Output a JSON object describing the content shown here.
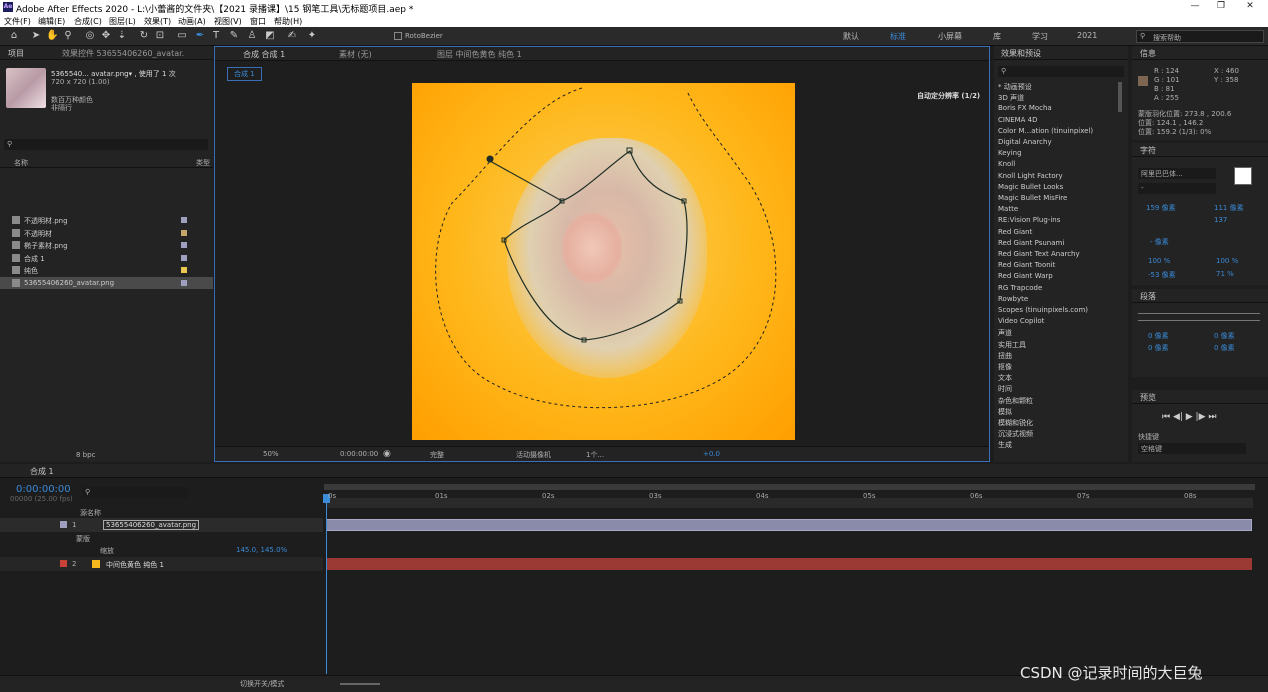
{
  "app": {
    "title": "Adobe After Effects 2020 - L:\\小蕾酱的文件夹\\【2021 录播课】\\15 钢笔工具\\无标题项目.aep *",
    "logo": "Ae"
  },
  "menu": [
    "文件(F)",
    "编辑(E)",
    "合成(C)",
    "图层(L)",
    "效果(T)",
    "动画(A)",
    "视图(V)",
    "窗口",
    "帮助(H)"
  ],
  "toolbar": {
    "rotobezier": "RotoBezier",
    "workspaces": [
      "默认",
      "标准",
      "小屏幕",
      "库",
      "学习",
      "2021"
    ],
    "active_ws": "标准",
    "search": "搜索帮助"
  },
  "project": {
    "tab": "项目",
    "tab2": "效果控件 53655406260_avatar.",
    "file_name": "5365540... avatar.png▾ , 使用了 1 次",
    "file_dims": "720 x 720 (1.00)",
    "file_desc1": "数百万种颜色",
    "file_desc2": "非隔行",
    "col_name": "名称",
    "col_type": "类型",
    "items": [
      {
        "name": "不透明材.png",
        "color": "#9fa0c0"
      },
      {
        "name": "不透明材",
        "color": "#c4a86a"
      },
      {
        "name": "椭子素材.png",
        "color": "#9fa0c0"
      },
      {
        "name": "合成 1",
        "color": "#9fa0c0"
      },
      {
        "name": "纯色",
        "color": "#e8c850"
      },
      {
        "name": "53655406260_avatar.png",
        "color": "#9fa0c0"
      }
    ],
    "bpc": "8 bpc"
  },
  "comp": {
    "tab": "合成 合成 1",
    "footage_tab": "素材 (无)",
    "layer_tab": "图层 中间色黄色 纯色 1",
    "crumb": "合成 1",
    "renderer": "自动定分辨率 (1/2)",
    "zoom": "50%",
    "timecode": "0:00:00:00",
    "quality": "完整",
    "camera": "活动摄像机",
    "views": "1个...",
    "exposure": "+0.0"
  },
  "effects": {
    "title": "效果和预设",
    "items": [
      "* 动画预设",
      "3D 声道",
      "Boris FX Mocha",
      "CINEMA 4D",
      "Color M...ation (tinuinpixel)",
      "Digital Anarchy",
      "Keying",
      "Knoll",
      "Knoll Light Factory",
      "Magic Bullet Looks",
      "Magic Bullet MisFire",
      "Matte",
      "RE:Vision Plug-ins",
      "Red Giant",
      "Red Giant Psunami",
      "Red Giant Text Anarchy",
      "Red Giant Toonit",
      "Red Giant Warp",
      "RG Trapcode",
      "Rowbyte",
      "Scopes (tinuinpixels.com)",
      "Video Copilot",
      "声道",
      "实用工具",
      "扭曲",
      "抠像",
      "文本",
      "时间",
      "杂色和颗粒",
      "模拟",
      "模糊和锐化",
      "沉浸式视频",
      "生成"
    ]
  },
  "info": {
    "title": "信息",
    "r": "R : 124",
    "g": "G : 101",
    "b": "B : 81",
    "a": "A : 255",
    "x": "X : 460",
    "y": "Y : 358",
    "line1": "蒙版羽化位置: 273.8 , 200.6",
    "line2": "位置: 124.1 , 146.2",
    "line3": "位置: 159.2 (1/3): 0%",
    "swatch": "#7c6551"
  },
  "character": {
    "title": "字符",
    "font": "阿里巴巴体...",
    "style": "-",
    "size": "159 像素",
    "leading": "111 像素",
    "tracking": "137",
    "stroke": "- 像素",
    "scale_v": "100 %",
    "scale_h": "100 %",
    "baseline": "-53 像素",
    "tsume": "71 %"
  },
  "paragraph": {
    "title": "段落",
    "v0": "0 像素",
    "v1": "0 像素",
    "v2": "0 像素",
    "v3": "0 像素"
  },
  "preview": {
    "title": "预览",
    "shortcut_label": "快捷键",
    "shortcut": "空格键"
  },
  "timeline": {
    "tab": "合成 1",
    "timecode": "0:00:00:00",
    "fps": "00000 (25.00 fps)",
    "col_name": "源名称",
    "layers": [
      {
        "num": "1",
        "name": "53655406260_avatar.png",
        "color": "#9fa0c0"
      },
      {
        "num": "2",
        "name": "中间色黄色 纯色 1",
        "color": "#c8423a"
      }
    ],
    "sub_mask": "蒙版",
    "sub_scale": "缩放",
    "scale_val": "145.0, 145.0%",
    "ticks": [
      "0s",
      "01s",
      "02s",
      "03s",
      "04s",
      "05s",
      "06s",
      "07s",
      "08s"
    ],
    "toggle": "切换开关/模式"
  },
  "watermark": "CSDN @记录时间的大巨兔"
}
